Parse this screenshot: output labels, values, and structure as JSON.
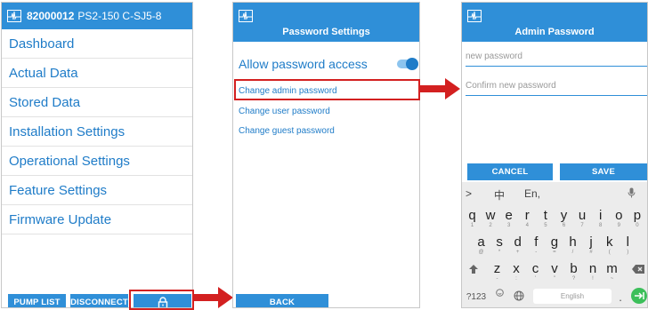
{
  "screen1": {
    "pump_id": "82000012",
    "pump_model": "PS2-150 C-SJ5-8",
    "menu": [
      "Dashboard",
      "Actual Data",
      "Stored Data",
      "Installation Settings",
      "Operational Settings",
      "Feature Settings",
      "Firmware Update"
    ],
    "buttons": {
      "pump_list": "PUMP LIST",
      "disconnect": "DISCONNECT"
    },
    "lock_icon": "lock-icon"
  },
  "screen2": {
    "title": "Password Settings",
    "toggle_label": "Allow password access",
    "toggle_on": true,
    "links": [
      "Change admin password",
      "Change user password",
      "Change guest password"
    ],
    "back": "BACK"
  },
  "screen3": {
    "title": "Admin Password",
    "new_password_placeholder": "new password",
    "confirm_placeholder": "Confirm new password",
    "cancel": "CANCEL",
    "save": "SAVE",
    "keyboard": {
      "top": [
        ">",
        "中",
        "En,",
        "🎙"
      ],
      "row1": [
        [
          "q",
          "1"
        ],
        [
          "w",
          "2"
        ],
        [
          "e",
          "3"
        ],
        [
          "r",
          "4"
        ],
        [
          "t",
          "5"
        ],
        [
          "y",
          "6"
        ],
        [
          "u",
          "7"
        ],
        [
          "i",
          "8"
        ],
        [
          "o",
          "9"
        ],
        [
          "p",
          "0"
        ]
      ],
      "row2": [
        [
          "a",
          "@"
        ],
        [
          "s",
          "*"
        ],
        [
          "d",
          "+"
        ],
        [
          "f",
          "-"
        ],
        [
          "g",
          "="
        ],
        [
          "h",
          "/"
        ],
        [
          "j",
          "#"
        ],
        [
          "k",
          "("
        ],
        [
          "l",
          ")"
        ]
      ],
      "row3": [
        [
          "z",
          "-"
        ],
        [
          "x",
          ":"
        ],
        [
          "c",
          "'"
        ],
        [
          "v",
          "\""
        ],
        [
          "b",
          "?"
        ],
        [
          "n",
          "!"
        ],
        [
          "m",
          "~"
        ]
      ],
      "num_key": "?123",
      "space_label": "English",
      "period": "."
    }
  },
  "colors": {
    "accent": "#2f8fd8",
    "highlight": "#d32020",
    "text_blue": "#1f7cc8"
  }
}
